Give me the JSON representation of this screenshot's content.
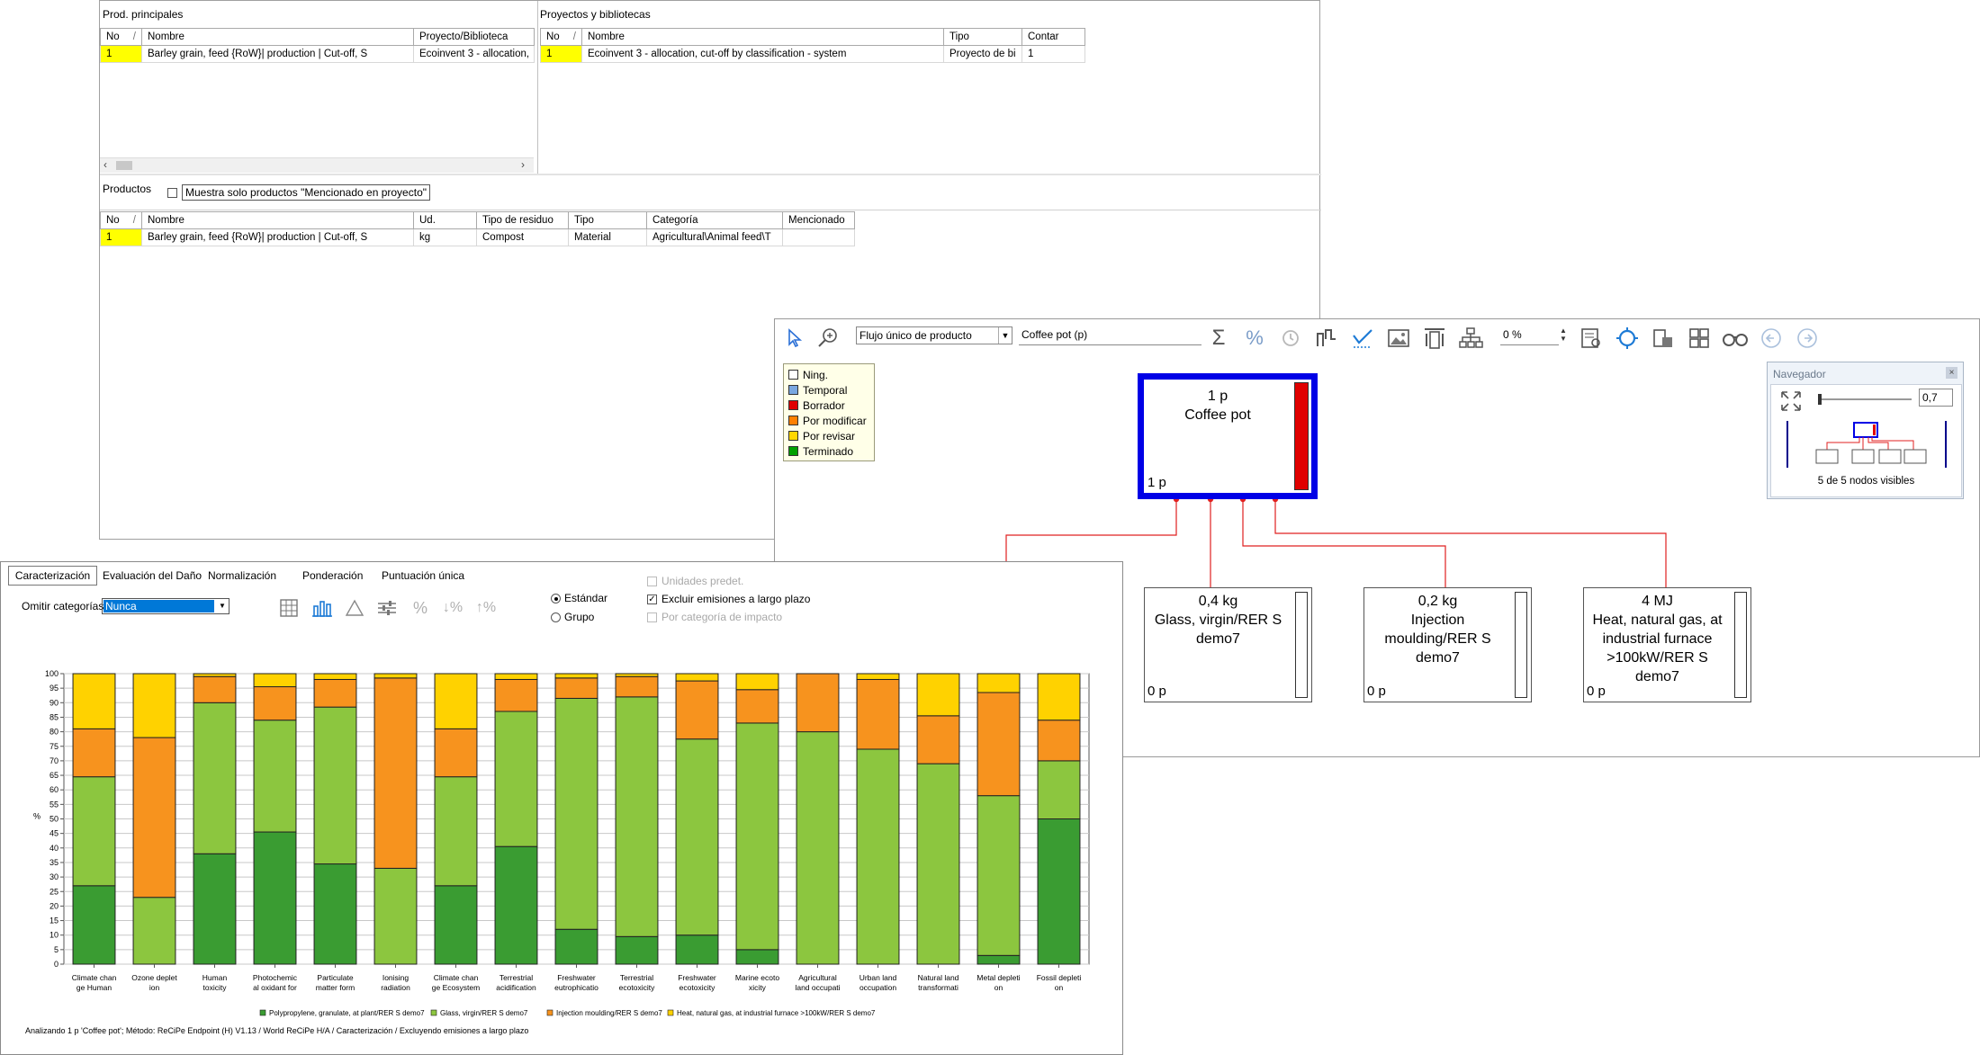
{
  "top_window": {
    "prod_principales": {
      "title": "Prod. principales",
      "columns": [
        "No",
        "Nombre",
        "Proyecto/Biblioteca"
      ],
      "rows": [
        [
          "1",
          "Barley grain, feed {RoW}| production | Cut-off, S",
          "Ecoinvent 3 - allocation,"
        ]
      ]
    },
    "proyectos": {
      "title": "Proyectos y bibliotecas",
      "columns": [
        "No",
        "Nombre",
        "Tipo",
        "Contar"
      ],
      "rows": [
        [
          "1",
          "Ecoinvent 3 - allocation, cut-off by classification - system",
          "Proyecto de bi",
          "1"
        ]
      ]
    },
    "productos": {
      "title": "Productos",
      "checkbox_label": "Muestra solo productos \"Mencionado en proyecto\"",
      "columns": [
        "No",
        "Nombre",
        "Ud.",
        "Tipo de residuo",
        "Tipo",
        "Categoría",
        "Mencionado"
      ],
      "rows": [
        [
          "1",
          "Barley grain, feed {RoW}| production | Cut-off, S",
          "kg",
          "Compost",
          "Material",
          "Agricultural\\Animal feed\\T",
          ""
        ]
      ]
    },
    "sort_glyph": "/"
  },
  "network_window": {
    "toolbar": {
      "flow_select": "Flujo único de producto",
      "product_field": "Coffee pot (p)",
      "percent_value": "0 %"
    },
    "legend": [
      {
        "label": "Ning.",
        "color": "#ffffff"
      },
      {
        "label": "Temporal",
        "color": "#7aa7e0"
      },
      {
        "label": "Borrador",
        "color": "#e00000"
      },
      {
        "label": "Por modificar",
        "color": "#ff8000"
      },
      {
        "label": "Por revisar",
        "color": "#ffd700"
      },
      {
        "label": "Terminado",
        "color": "#00a000"
      }
    ],
    "root_node": {
      "amount": "1 p",
      "name": "Coffee pot",
      "bottom": "1 p"
    },
    "child_nodes": [
      {
        "amount": "0,4 kg",
        "name": "Glass, virgin/RER S demo7",
        "bottom": "0 p"
      },
      {
        "amount": "0,2 kg",
        "name": "Injection moulding/RER S demo7",
        "bottom": "0 p"
      },
      {
        "amount": "4 MJ",
        "name": "Heat, natural gas, at industrial furnace >100kW/RER S demo7",
        "bottom": "0 p"
      }
    ],
    "navigator": {
      "title": "Navegador",
      "zoom_value": "0,7",
      "status": "5 de 5 nodos visibles"
    }
  },
  "chart_window": {
    "tabs": [
      "Caracterización",
      "Evaluación del Daño",
      "Normalización",
      "Ponderación",
      "Puntuación única"
    ],
    "omit_label": "Omitir categorías",
    "omit_value": "Nunca",
    "radio_options": [
      "Estándar",
      "Grupo"
    ],
    "checkboxes": [
      {
        "label": "Unidades predet.",
        "checked": false,
        "disabled": true
      },
      {
        "label": "Excluir emisiones a largo plazo",
        "checked": true,
        "disabled": false
      },
      {
        "label": "Por categoría de impacto",
        "checked": false,
        "disabled": true
      }
    ],
    "y_axis_label": "%",
    "footer": "Analizando 1 p 'Coffee pot'; Método: ReCiPe Endpoint (H) V1.13 / World ReCiPe H/A / Caracterización / Excluyendo emisiones a largo plazo",
    "colors": {
      "s1": "#3a9c32",
      "s2": "#8cc63f",
      "s3": "#f7931e",
      "s4": "#ffd200"
    }
  },
  "chart_data": {
    "type": "bar",
    "stacked": true,
    "categories": [
      "Climate change Human",
      "Ozone depletion",
      "Human toxicity",
      "Photochemical oxidant for",
      "Particulate matter form",
      "Ionising radiation",
      "Climate change Ecosystem",
      "Terrestrial acidification",
      "Freshwater eutrophication",
      "Terrestrial ecotoxicity",
      "Freshwater ecotoxicity",
      "Marine ecotoxicity",
      "Agricultural land occupation",
      "Urban land occupation",
      "Natural land transformation",
      "Metal depletion",
      "Fossil depletion"
    ],
    "category_labels": [
      [
        "Climate chan",
        "ge Human"
      ],
      [
        "Ozone deplet",
        "ion"
      ],
      [
        "Human",
        "toxicity"
      ],
      [
        "Photochemic",
        "al oxidant for"
      ],
      [
        "Particulate",
        "matter form"
      ],
      [
        "Ionising",
        "radiation"
      ],
      [
        "Climate chan",
        "ge Ecosystem"
      ],
      [
        "Terrestrial",
        "acidification"
      ],
      [
        "Freshwater",
        "eutrophicatio"
      ],
      [
        "Terrestrial",
        "ecotoxicity"
      ],
      [
        "Freshwater",
        "ecotoxicity"
      ],
      [
        "Marine ecoto",
        "xicity"
      ],
      [
        "Agricultural",
        "land occupati"
      ],
      [
        "Urban land",
        "occupation"
      ],
      [
        "Natural land",
        "transformati"
      ],
      [
        "Metal depleti",
        "on"
      ],
      [
        "Fossil depleti",
        "on"
      ]
    ],
    "series": [
      {
        "name": "Polypropylene, granulate, at plant/RER S demo7",
        "color": "#3a9c32",
        "values": [
          27,
          0,
          38,
          45.5,
          34.5,
          0,
          27,
          40.5,
          12,
          9.5,
          10,
          5,
          0,
          0,
          0,
          3,
          50
        ]
      },
      {
        "name": "Glass, virgin/RER S demo7",
        "color": "#8cc63f",
        "values": [
          37.5,
          23,
          52,
          38.5,
          54,
          33,
          37.5,
          46.5,
          79.5,
          82.5,
          67.5,
          78,
          80,
          74,
          69,
          55,
          20
        ]
      },
      {
        "name": "Injection moulding/RER S demo7",
        "color": "#f7931e",
        "values": [
          16.5,
          55,
          9,
          11.5,
          9.5,
          65.5,
          16.5,
          11,
          7,
          7,
          20,
          11.5,
          20,
          24,
          16.5,
          35.5,
          14
        ]
      },
      {
        "name": "Heat, natural gas, at industrial furnace >100kW/RER S demo7",
        "color": "#ffd200",
        "values": [
          19,
          22,
          1,
          4.5,
          2,
          1.5,
          19,
          2,
          1.5,
          1,
          2.5,
          5.5,
          0,
          2,
          14.5,
          6.5,
          16
        ]
      }
    ],
    "ylim": [
      0,
      100
    ],
    "yticks": [
      0,
      5,
      10,
      15,
      20,
      25,
      30,
      35,
      40,
      45,
      50,
      55,
      60,
      65,
      70,
      75,
      80,
      85,
      90,
      95,
      100
    ],
    "ylabel": "%",
    "grid": true,
    "legend_position": "bottom"
  }
}
